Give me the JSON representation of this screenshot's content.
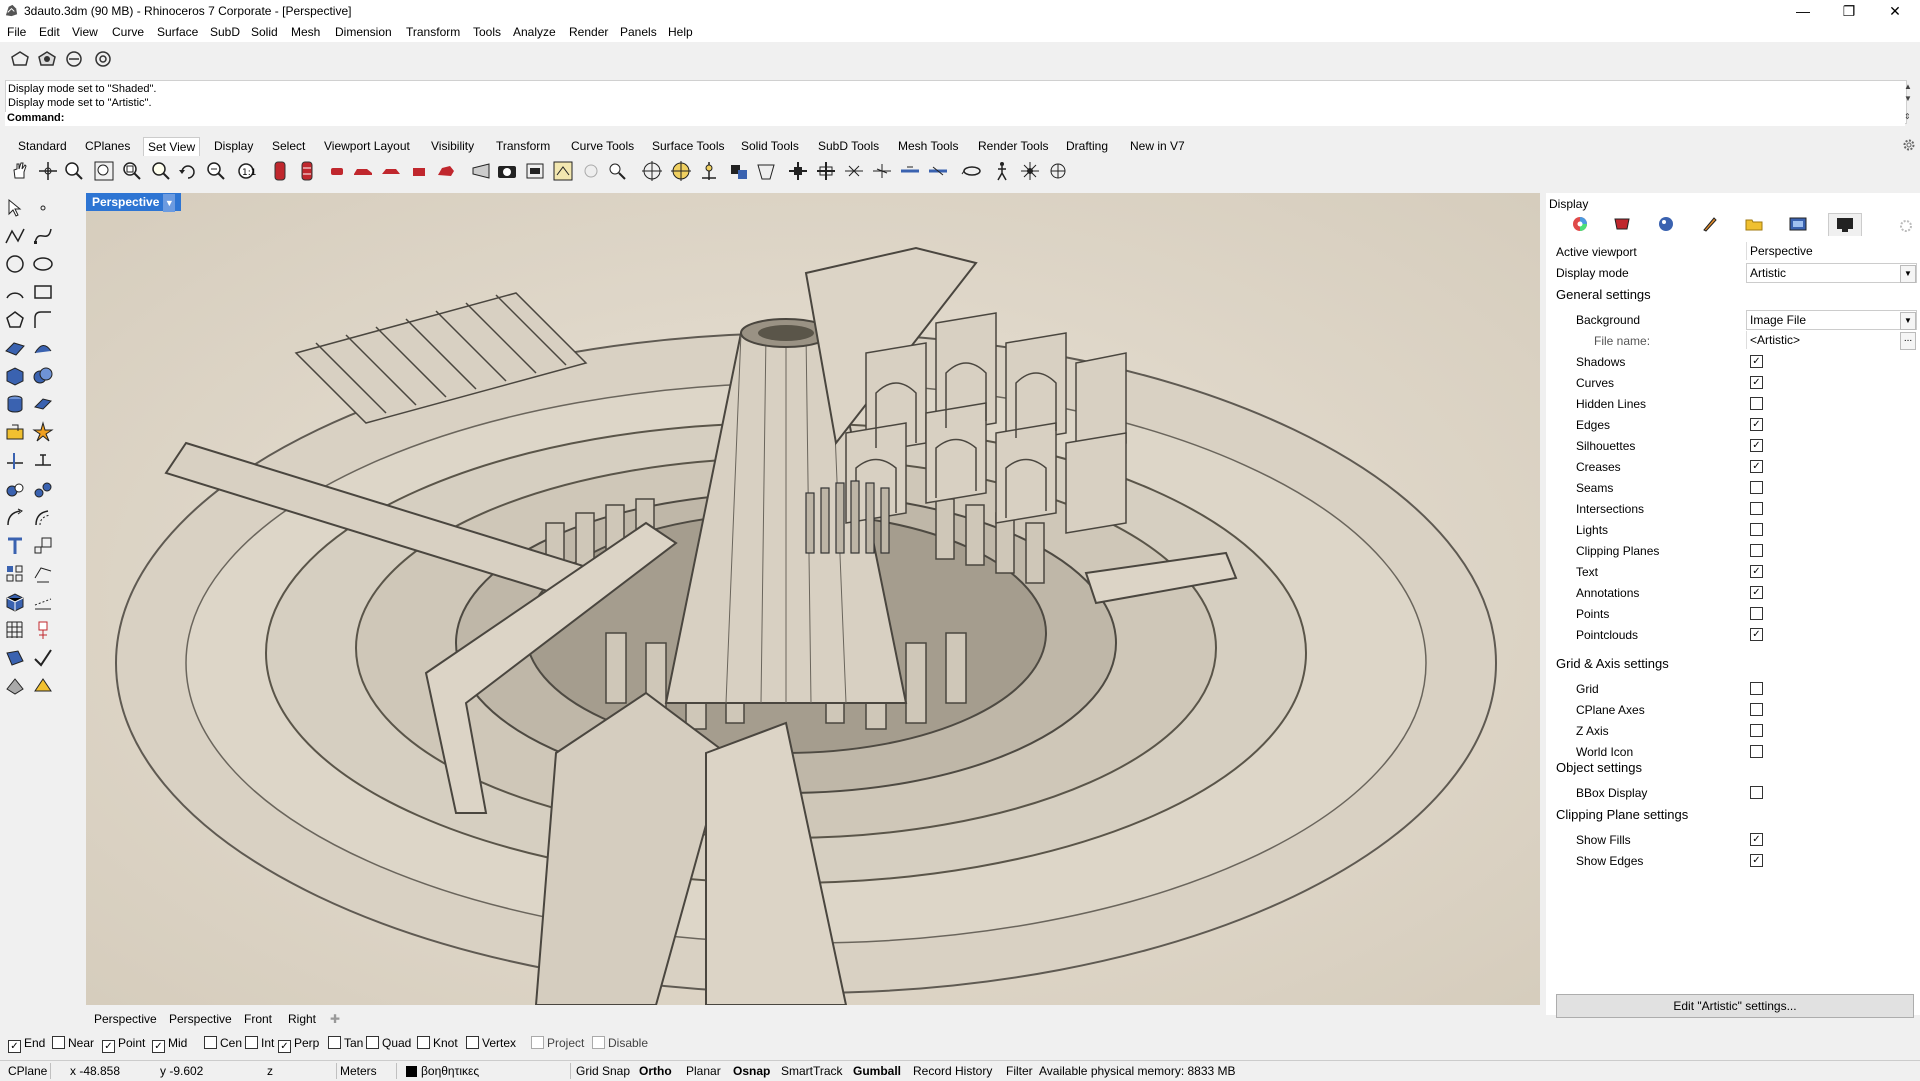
{
  "window": {
    "title": "3dauto.3dm (90 MB) - Rhinoceros 7 Corporate - [Perspective]",
    "minimize_glyph": "—",
    "maximize_glyph": "❐",
    "close_glyph": "✕"
  },
  "menu": [
    "File",
    "Edit",
    "View",
    "Curve",
    "Surface",
    "SubD",
    "Solid",
    "Mesh",
    "Dimension",
    "Transform",
    "Tools",
    "Analyze",
    "Render",
    "Panels",
    "Help"
  ],
  "command": {
    "history": [
      "Display mode set to \"Shaded\".",
      "Display mode set to \"Artistic\"."
    ],
    "prompt": "Command:"
  },
  "toolbar_tabs": [
    "Standard",
    "CPlanes",
    "Set View",
    "Display",
    "Select",
    "Viewport Layout",
    "Visibility",
    "Transform",
    "Curve Tools",
    "Surface Tools",
    "Solid Tools",
    "SubD Tools",
    "Mesh Tools",
    "Render Tools",
    "Drafting",
    "New in V7"
  ],
  "active_toolbar_tab": "Set View",
  "viewport": {
    "label": "Perspective",
    "tabs": [
      "Perspective",
      "Perspective",
      "Front",
      "Right"
    ],
    "add_tab_glyph": "✚"
  },
  "panel": {
    "title": "Display",
    "active_viewport_label": "Active viewport",
    "active_viewport_value": "Perspective",
    "display_mode_label": "Display mode",
    "display_mode_value": "Artistic",
    "general_settings": "General settings",
    "background_label": "Background",
    "background_value": "Image File",
    "filename_label": "File name:",
    "filename_value": "<Artistic>",
    "filename_btn": "...",
    "general_items": [
      {
        "label": "Shadows",
        "checked": true
      },
      {
        "label": "Curves",
        "checked": true
      },
      {
        "label": "Hidden Lines",
        "checked": false
      },
      {
        "label": "Edges",
        "checked": true
      },
      {
        "label": "Silhouettes",
        "checked": true
      },
      {
        "label": "Creases",
        "checked": true
      },
      {
        "label": "Seams",
        "checked": false
      },
      {
        "label": "Intersections",
        "checked": false
      },
      {
        "label": "Lights",
        "checked": false
      },
      {
        "label": "Clipping Planes",
        "checked": false
      },
      {
        "label": "Text",
        "checked": true
      },
      {
        "label": "Annotations",
        "checked": true
      },
      {
        "label": "Points",
        "checked": false
      },
      {
        "label": "Pointclouds",
        "checked": true
      }
    ],
    "grid_settings": "Grid & Axis settings",
    "grid_items": [
      {
        "label": "Grid",
        "checked": false
      },
      {
        "label": "CPlane Axes",
        "checked": false
      },
      {
        "label": "Z Axis",
        "checked": false
      },
      {
        "label": "World Icon",
        "checked": false
      }
    ],
    "object_settings": "Object settings",
    "object_items": [
      {
        "label": "BBox Display",
        "checked": false
      }
    ],
    "clipping_settings": "Clipping Plane settings",
    "clipping_items": [
      {
        "label": "Show Fills",
        "checked": true
      },
      {
        "label": "Show Edges",
        "checked": true
      }
    ],
    "edit_button": "Edit \"Artistic\" settings..."
  },
  "osnaps": [
    {
      "label": "End",
      "checked": true,
      "enabled": true
    },
    {
      "label": "Near",
      "checked": false,
      "enabled": true
    },
    {
      "label": "Point",
      "checked": true,
      "enabled": true
    },
    {
      "label": "Mid",
      "checked": true,
      "enabled": true
    },
    {
      "label": "Cen",
      "checked": false,
      "enabled": true
    },
    {
      "label": "Int",
      "checked": false,
      "enabled": true
    },
    {
      "label": "Perp",
      "checked": true,
      "enabled": true
    },
    {
      "label": "Tan",
      "checked": false,
      "enabled": true
    },
    {
      "label": "Quad",
      "checked": false,
      "enabled": true
    },
    {
      "label": "Knot",
      "checked": false,
      "enabled": true
    },
    {
      "label": "Vertex",
      "checked": false,
      "enabled": true
    },
    {
      "label": "Project",
      "checked": false,
      "enabled": false
    },
    {
      "label": "Disable",
      "checked": false,
      "enabled": false
    }
  ],
  "status": {
    "cplane": "CPlane",
    "x": "x -48.858",
    "y": "y -9.602",
    "z": "z",
    "units": "Meters",
    "layer": "βοηθητικες",
    "layer_color": "#000000",
    "grid_snap": "Grid Snap",
    "ortho": "Ortho",
    "planar": "Planar",
    "osnap": "Osnap",
    "smarttrack": "SmartTrack",
    "gumball": "Gumball",
    "record_history": "Record History",
    "filter": "Filter",
    "memory": "Available physical memory: 8833 MB"
  },
  "colors": {
    "viewport_bg": "#e1dace",
    "active_label": "#2e75d3"
  }
}
